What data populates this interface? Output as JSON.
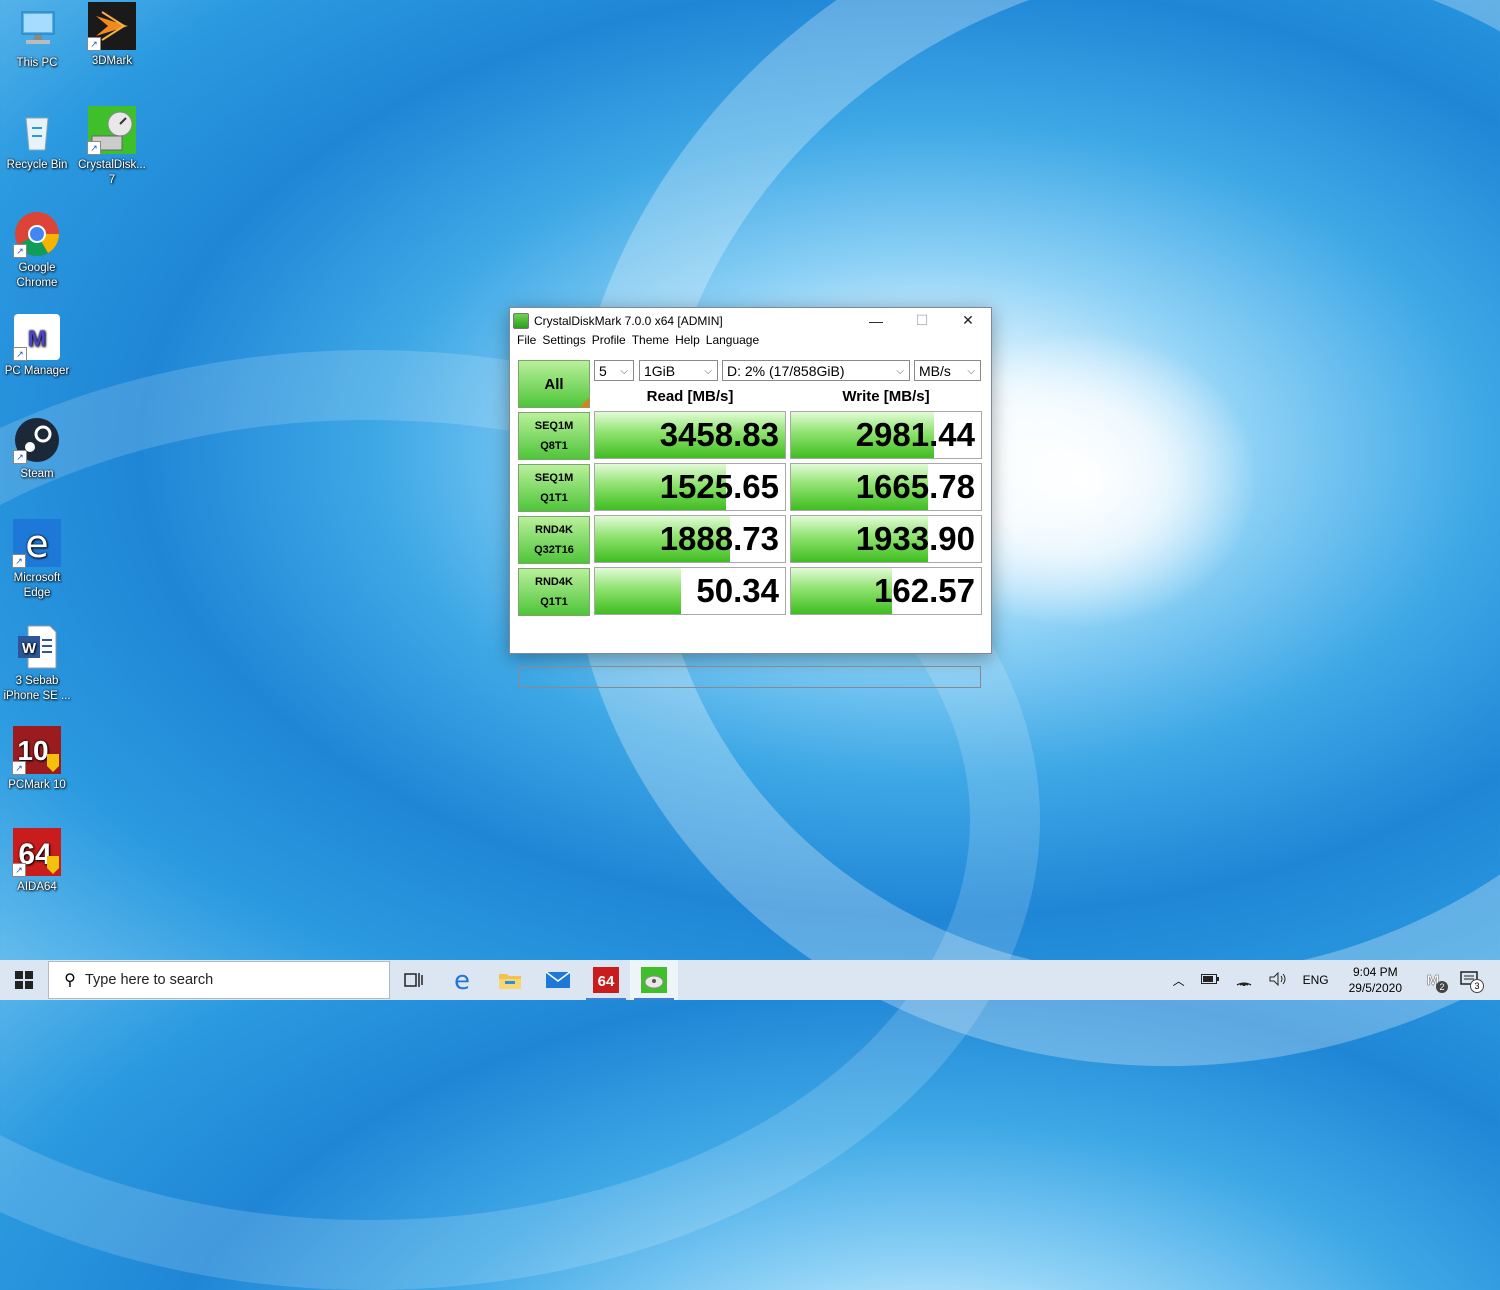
{
  "desktop": {
    "icons": [
      {
        "label": "This PC",
        "icon": "this-pc-icon"
      },
      {
        "label": "3DMark",
        "icon": "3dmark-icon"
      },
      {
        "label": "Recycle Bin",
        "icon": "recycle-bin-icon"
      },
      {
        "label": "CrystalDisk... 7",
        "icon": "crystaldiskmark-icon"
      },
      {
        "label": "Google Chrome",
        "icon": "chrome-icon"
      },
      {
        "label": "PC Manager",
        "icon": "pc-manager-icon"
      },
      {
        "label": "Steam",
        "icon": "steam-icon"
      },
      {
        "label": "Microsoft Edge",
        "icon": "edge-icon"
      },
      {
        "label": "3 Sebab iPhone SE ...",
        "icon": "word-doc-icon"
      },
      {
        "label": "PCMark 10",
        "icon": "pcmark-icon"
      },
      {
        "label": "AIDA64",
        "icon": "aida64-icon"
      }
    ]
  },
  "window": {
    "title": "CrystalDiskMark 7.0.0 x64 [ADMIN]",
    "controls": {
      "minimize": "—",
      "maximize": "☐",
      "close": "✕"
    },
    "menu": [
      "File",
      "Settings",
      "Profile",
      "Theme",
      "Help",
      "Language"
    ],
    "all_label": "All",
    "count": "5",
    "size": "1GiB",
    "drive": "D: 2% (17/858GiB)",
    "unit": "MB/s",
    "read_header": "Read [MB/s]",
    "write_header": "Write [MB/s]",
    "rows": [
      {
        "line1": "SEQ1M",
        "line2": "Q8T1",
        "read": "3458.83",
        "write": "2981.44"
      },
      {
        "line1": "SEQ1M",
        "line2": "Q1T1",
        "read": "1525.65",
        "write": "1665.78"
      },
      {
        "line1": "RND4K",
        "line2": "Q32T16",
        "read": "1888.73",
        "write": "1933.90"
      },
      {
        "line1": "RND4K",
        "line2": "Q1T1",
        "read": "50.34",
        "write": "162.57"
      }
    ],
    "comment": ""
  },
  "taskbar": {
    "search_placeholder": "Type here to search",
    "language": "ENG",
    "time": "9:04 PM",
    "date": "29/5/2020",
    "notif_count": "3",
    "pcm_badge": "2"
  }
}
